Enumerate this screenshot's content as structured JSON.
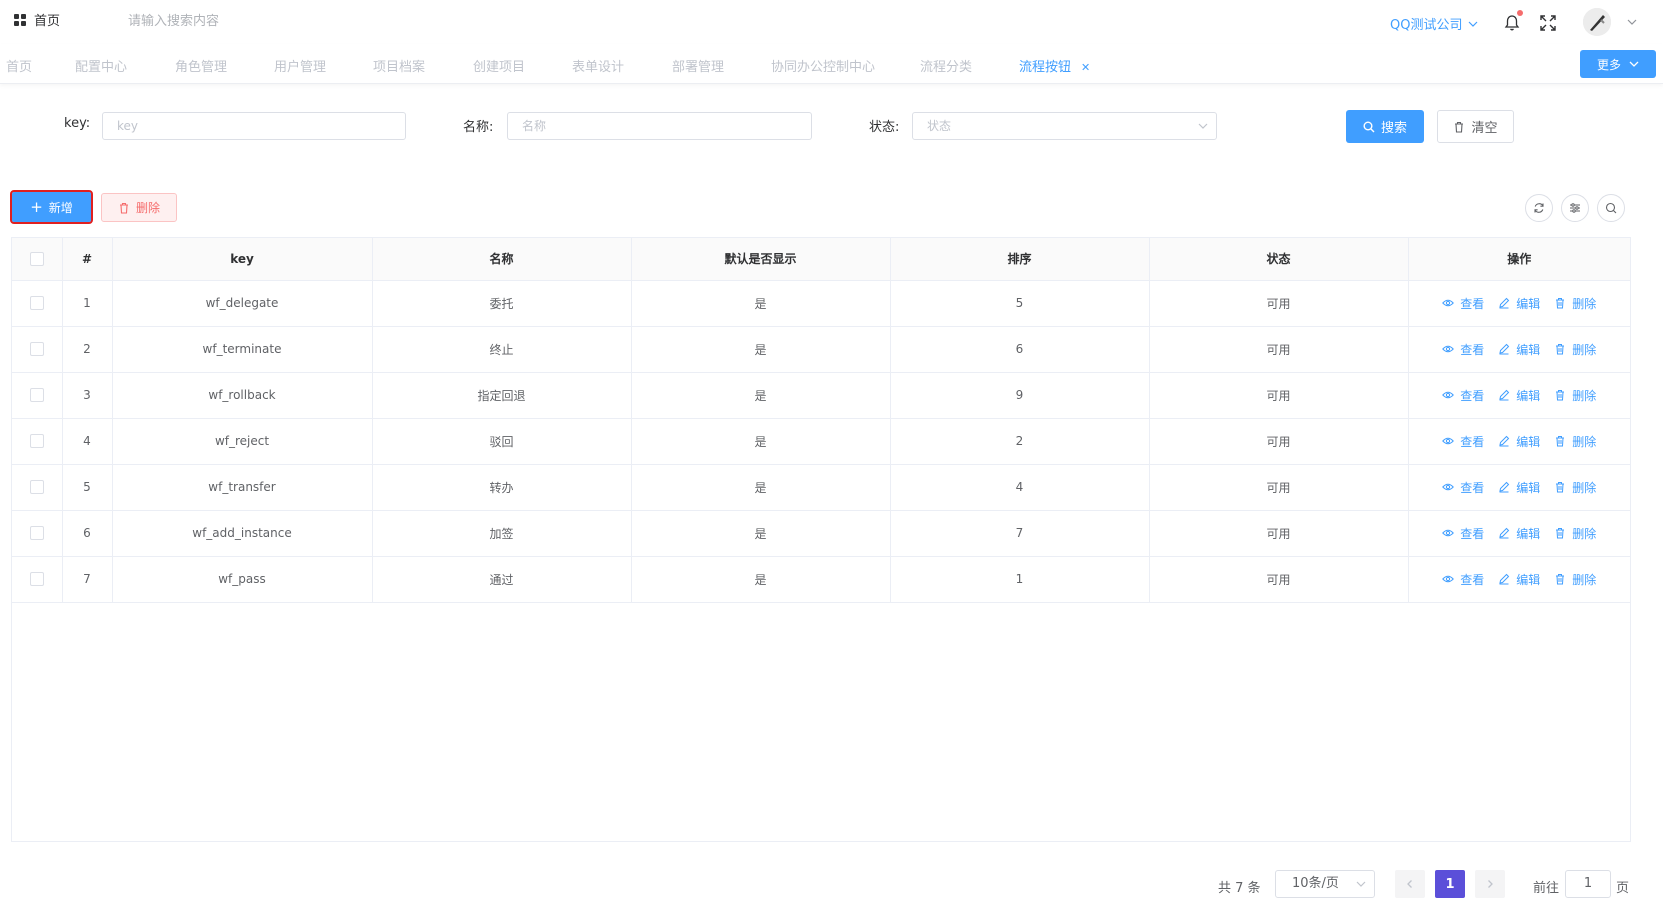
{
  "header": {
    "home_label": "首页",
    "search_placeholder": "请输入搜索内容",
    "company": "QQ测试公司"
  },
  "tabs": [
    {
      "label": "首页"
    },
    {
      "label": "配置中心"
    },
    {
      "label": "角色管理"
    },
    {
      "label": "用户管理"
    },
    {
      "label": "项目档案"
    },
    {
      "label": "创建项目"
    },
    {
      "label": "表单设计"
    },
    {
      "label": "部署管理"
    },
    {
      "label": "协同办公控制中心"
    },
    {
      "label": "流程分类"
    },
    {
      "label": "流程按钮",
      "active": true
    }
  ],
  "more_label": "更多",
  "filters": {
    "key_label": "key:",
    "key_placeholder": "key",
    "name_label": "名称:",
    "name_placeholder": "名称",
    "status_label": "状态:",
    "status_placeholder": "状态",
    "search_btn": "搜索",
    "clear_btn": "清空"
  },
  "toolbar": {
    "add_label": "新增",
    "delete_label": "删除"
  },
  "table": {
    "headers": [
      "#",
      "key",
      "名称",
      "默认是否显示",
      "排序",
      "状态",
      "操作"
    ],
    "rows": [
      {
        "index": "1",
        "key": "wf_delegate",
        "name": "委托",
        "default_show": "是",
        "sort": "5",
        "status": "可用"
      },
      {
        "index": "2",
        "key": "wf_terminate",
        "name": "终止",
        "default_show": "是",
        "sort": "6",
        "status": "可用"
      },
      {
        "index": "3",
        "key": "wf_rollback",
        "name": "指定回退",
        "default_show": "是",
        "sort": "9",
        "status": "可用"
      },
      {
        "index": "4",
        "key": "wf_reject",
        "name": "驳回",
        "default_show": "是",
        "sort": "2",
        "status": "可用"
      },
      {
        "index": "5",
        "key": "wf_transfer",
        "name": "转办",
        "default_show": "是",
        "sort": "4",
        "status": "可用"
      },
      {
        "index": "6",
        "key": "wf_add_instance",
        "name": "加签",
        "default_show": "是",
        "sort": "7",
        "status": "可用"
      },
      {
        "index": "7",
        "key": "wf_pass",
        "name": "通过",
        "default_show": "是",
        "sort": "1",
        "status": "可用"
      }
    ],
    "ops": {
      "view": "查看",
      "edit": "编辑",
      "delete": "删除"
    }
  },
  "pagination": {
    "total": "共 7 条",
    "page_size": "10条/页",
    "current_page": "1",
    "goto_label": "前往",
    "goto_value": "1",
    "page_suffix": "页"
  },
  "colors": {
    "primary": "#409eff",
    "danger": "#f56c6c",
    "pager_active": "#5b4fd9",
    "highlight_border": "#e02020"
  }
}
